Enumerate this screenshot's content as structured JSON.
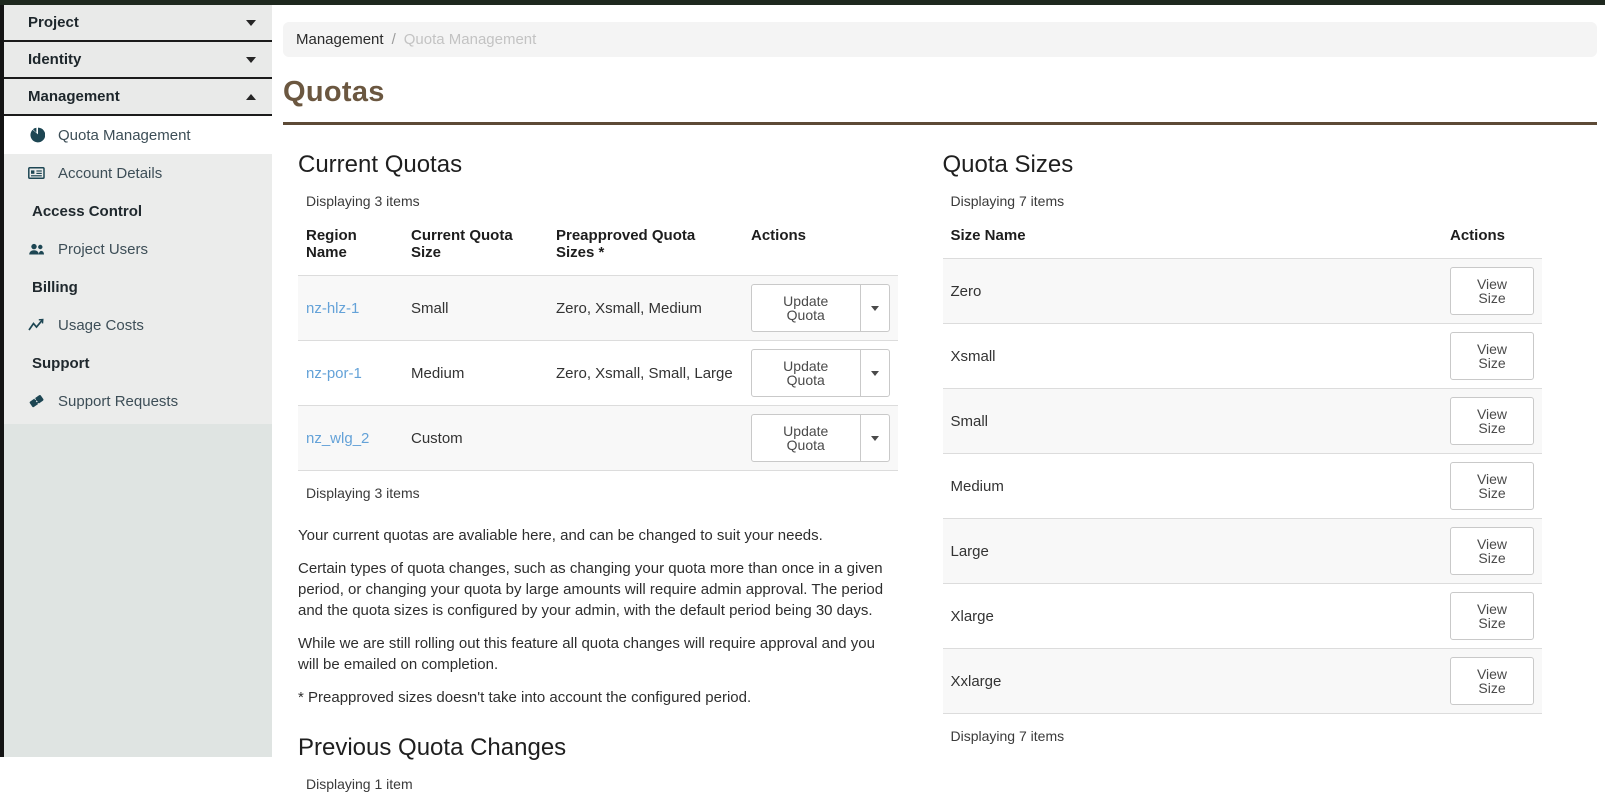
{
  "page_title": "Quotas",
  "breadcrumb": {
    "items": [
      "Management",
      "Quota Management"
    ],
    "separator": "/"
  },
  "sidebar": {
    "accordions": [
      {
        "label": "Project",
        "state": "collapsed"
      },
      {
        "label": "Identity",
        "state": "collapsed"
      },
      {
        "label": "Management",
        "state": "expanded"
      }
    ],
    "items": [
      {
        "label": "Quota Management",
        "icon": "pie-chart",
        "active": true
      },
      {
        "label": "Account Details",
        "icon": "id-card",
        "active": false
      },
      {
        "label": "Access Control",
        "type": "section"
      },
      {
        "label": "Project Users",
        "icon": "users",
        "active": false
      },
      {
        "label": "Billing",
        "type": "section"
      },
      {
        "label": "Usage Costs",
        "icon": "line-chart",
        "active": false
      },
      {
        "label": "Support",
        "type": "section"
      },
      {
        "label": "Support Requests",
        "icon": "ticket",
        "active": false
      }
    ]
  },
  "current_quotas": {
    "heading": "Current Quotas",
    "count_top": "Displaying 3 items",
    "count_bottom": "Displaying 3 items",
    "columns": [
      "Region Name",
      "Current Quota Size",
      "Preapproved Quota Sizes *",
      "Actions"
    ],
    "action_label": "Update Quota",
    "rows": [
      {
        "region": "nz-hlz-1",
        "size": "Small",
        "preapproved": "Zero, Xsmall, Medium"
      },
      {
        "region": "nz-por-1",
        "size": "Medium",
        "preapproved": "Zero, Xsmall, Small, Large"
      },
      {
        "region": "nz_wlg_2",
        "size": "Custom",
        "preapproved": ""
      }
    ],
    "notes": [
      "Your current quotas are avaliable here, and can be changed to suit your needs.",
      "Certain types of quota changes, such as changing your quota more than once in a given period, or changing your quota by large amounts will require admin approval. The period and the quota sizes is configured by your admin, with the default period being 30 days.",
      "While we are still rolling out this feature all quota changes will require approval and you will be emailed on completion.",
      "* Preapproved sizes doesn't take into account the configured period."
    ]
  },
  "previous_quota_changes": {
    "heading": "Previous Quota Changes",
    "count_top": "Displaying 1 item"
  },
  "quota_sizes": {
    "heading": "Quota Sizes",
    "count_top": "Displaying 7 items",
    "count_bottom": "Displaying 7 items",
    "columns": [
      "Size Name",
      "Actions"
    ],
    "action_label": "View Size",
    "rows": [
      {
        "name": "Zero"
      },
      {
        "name": "Xsmall"
      },
      {
        "name": "Small"
      },
      {
        "name": "Medium"
      },
      {
        "name": "Large"
      },
      {
        "name": "Xlarge"
      },
      {
        "name": "Xxlarge"
      }
    ]
  },
  "colors": {
    "top_bar": "#1e281e",
    "title_brown": "#6b5740",
    "rule_brown": "#5d4a36",
    "link_blue": "#64a2d8",
    "sidebar_icon_teal": "#1d4653",
    "sidebar_lower_bg": "#dfe4e2",
    "row_stripe": "#f8f8f8"
  }
}
